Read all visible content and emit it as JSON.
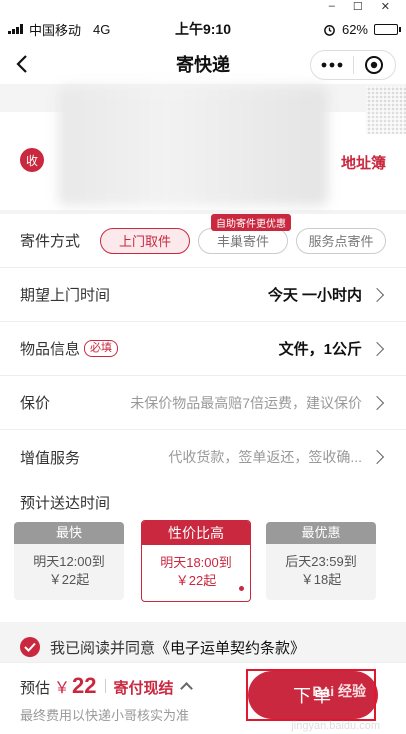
{
  "window_controls": {
    "minimize": "–",
    "maximize": "☐",
    "close": "✕"
  },
  "statusbar": {
    "carrier": "中国移动",
    "network": "4G",
    "time": "上午9:10",
    "battery": "62%",
    "battery_level": 0.62
  },
  "navbar": {
    "title": "寄快递"
  },
  "address": {
    "badge": "收",
    "book_label": "地址簿"
  },
  "form": {
    "method": {
      "label": "寄件方式",
      "options": [
        "上门取件",
        "丰巢寄件",
        "服务点寄件"
      ],
      "selected": "上门取件",
      "promo": "自助寄件更优惠"
    },
    "pickup_time": {
      "label": "期望上门时间",
      "value": "今天 一小时内"
    },
    "item": {
      "label": "物品信息",
      "required_tag": "必填",
      "value": "文件，1公斤"
    },
    "insurance": {
      "label": "保价",
      "value": "未保价物品最高赔7倍运费，建议保价"
    },
    "value_added": {
      "label": "增值服务",
      "value": "代收货款，签单返还，签收确..."
    }
  },
  "eta": {
    "title": "预计送达时间",
    "options": [
      {
        "tag": "最快",
        "line1": "明天12:00到",
        "line2": "￥22起"
      },
      {
        "tag": "性价比高",
        "line1": "明天18:00到",
        "line2": "￥22起"
      },
      {
        "tag": "最优惠",
        "line1": "后天23:59到",
        "line2": "￥18起"
      }
    ],
    "selected_index": 1
  },
  "agreement": {
    "text": "我已阅读并同意",
    "link": "《电子运单契约条款》"
  },
  "footer": {
    "estimate_label": "预估",
    "currency": "￥",
    "amount": "22",
    "pay_mode": "寄付现结",
    "note": "最终费用以快递小哥核实为准",
    "order_button": "下单",
    "watermark": "jingyan.baidu.com",
    "logo_text": "Bai 经验"
  },
  "colors": {
    "accent": "#c9283f",
    "background": "#f4f4f4"
  }
}
